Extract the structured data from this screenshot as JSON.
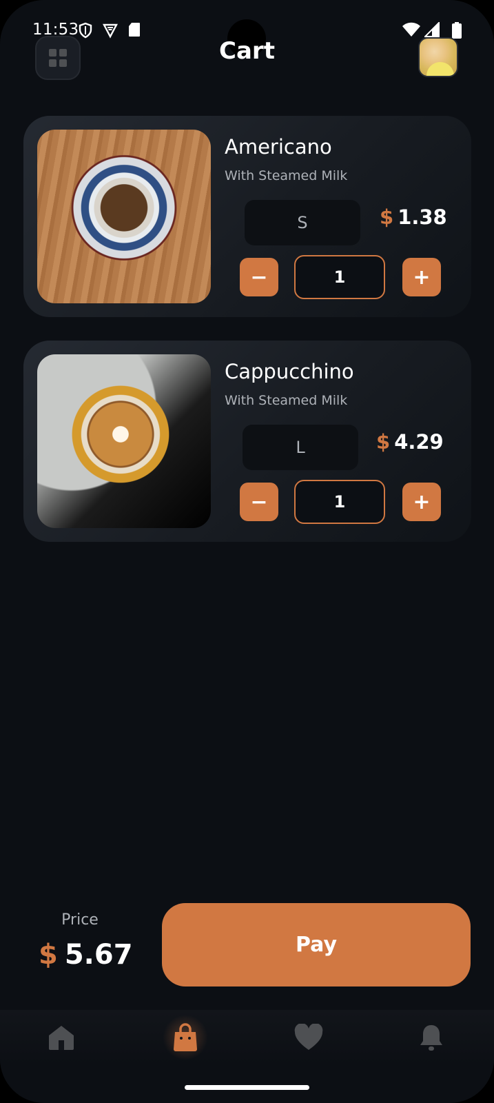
{
  "status_bar": {
    "time": "11:53",
    "left_icons": [
      "shield-icon",
      "vpn-icon",
      "sd-card-icon"
    ],
    "right_icons": [
      "wifi-icon",
      "signal-icon",
      "battery-icon"
    ]
  },
  "header": {
    "title": "Cart",
    "menu_icon": "grid-icon",
    "avatar": "profile-avatar"
  },
  "cart_items": [
    {
      "name": "Americano",
      "subtitle": "With Steamed Milk",
      "size": "S",
      "currency": "$",
      "price": "1.38",
      "quantity": "1",
      "minus_label": "−",
      "plus_label": "+",
      "image": "americano-cup-photo"
    },
    {
      "name": "Cappucchino",
      "subtitle": "With Steamed Milk",
      "size": "L",
      "currency": "$",
      "price": "4.29",
      "quantity": "1",
      "minus_label": "−",
      "plus_label": "+",
      "image": "cappuccino-latte-art-photo"
    }
  ],
  "summary": {
    "price_label": "Price",
    "currency": "$",
    "total": "5.67",
    "pay_label": "Pay"
  },
  "bottom_nav": [
    {
      "icon": "home-icon",
      "active": false
    },
    {
      "icon": "cart-bag-icon",
      "active": true
    },
    {
      "icon": "heart-icon",
      "active": false
    },
    {
      "icon": "bell-icon",
      "active": false
    }
  ],
  "colors": {
    "background": "#0c0f14",
    "accent": "#d17842",
    "card": "#252a32",
    "muted_text": "#aeb2b8",
    "inactive_icon": "#4e5053"
  }
}
